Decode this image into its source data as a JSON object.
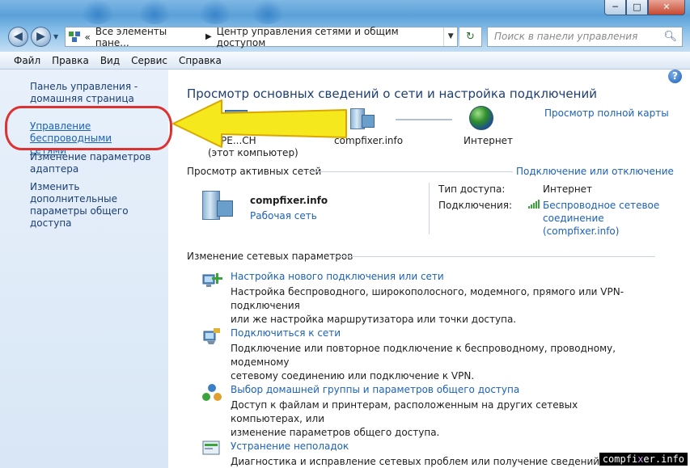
{
  "window": {
    "min_label": "─",
    "max_label": "□",
    "close_label": "✕"
  },
  "nav": {
    "back_glyph": "◀",
    "forward_glyph": "▶",
    "history_glyph": "▼"
  },
  "address": {
    "overflow": "«",
    "crumb_1": "Все элементы пане...",
    "separator": "▶",
    "crumb_2": "Центр управления сетями и общим доступом",
    "drop_glyph": "▼",
    "refresh_glyph": "↻"
  },
  "search": {
    "placeholder": "Поиск в панели управления",
    "icon": "search-icon"
  },
  "menu": [
    "Файл",
    "Правка",
    "Вид",
    "Сервис",
    "Справка"
  ],
  "sidebar": {
    "home_link": "Панель управления -",
    "home_link_2": "домашняя страница",
    "wireless_1": "Управление беспроводными",
    "wireless_2": "сетями",
    "adapter_1": "Изменение параметров",
    "adapter_2": "адаптера",
    "sharing_1": "Изменить дополнительные",
    "sharing_2": "параметры общего доступа"
  },
  "main": {
    "title": "Просмотр основных сведений о сети и настройка подключений",
    "full_map_link": "Просмотр полной карты",
    "help_glyph": "?",
    "map": {
      "pc_name": "РЕ...СН",
      "pc_sub": "(этот компьютер)",
      "network_name": "compfixer.info",
      "internet": "Интернет"
    },
    "active_networks": {
      "heading": "Просмотр активных сетей",
      "connect_link": "Подключение или отключение",
      "network_name": "compfixer.info",
      "network_type": "Рабочая сеть",
      "access_type_label": "Тип доступа:",
      "access_type_value": "Интернет",
      "connections_label": "Подключения:",
      "connection_1": "Беспроводное сетевое",
      "connection_2": "соединение",
      "connection_3": "(compfixer.info)"
    },
    "change_settings": {
      "heading": "Изменение сетевых параметров",
      "items": [
        {
          "title": "Настройка нового подключения или сети",
          "desc_1": "Настройка беспроводного, широкополосного, модемного, прямого или VPN-подключения",
          "desc_2": "или же настройка маршрутизатора или точки доступа."
        },
        {
          "title": "Подключиться к сети",
          "desc_1": "Подключение или повторное подключение к беспроводному, проводному, модемному",
          "desc_2": "сетевому соединению или подключение к VPN."
        },
        {
          "title": "Выбор домашней группы и параметров общего доступа",
          "desc_1": "Доступ к файлам и принтерам, расположенным на других сетевых компьютерах, или",
          "desc_2": "изменение параметров общего доступа."
        },
        {
          "title": "Устранение неполадок",
          "desc_1": "Диагностика и исправление сетевых проблем или получение сведений об исправл"
        }
      ]
    }
  },
  "watermark": {
    "part_1": "comp",
    "part_2": "fi",
    "part_3": "x",
    "part_4": "er.info"
  },
  "colors": {
    "link": "#1c61b8",
    "annotation_circle": "#dc3232",
    "annotation_arrow": "#f5e81c"
  }
}
